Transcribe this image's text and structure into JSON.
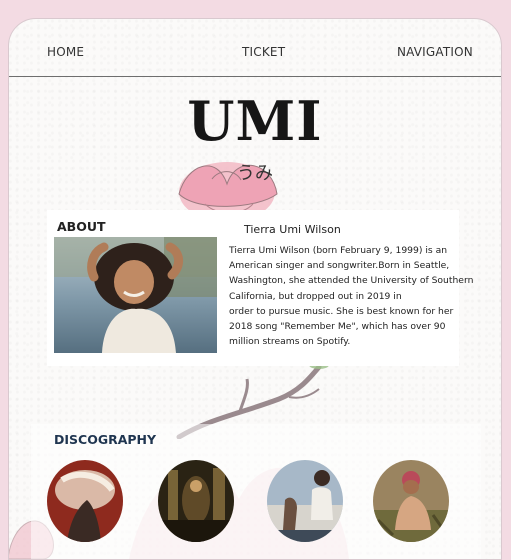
{
  "nav": {
    "home": "HOME",
    "ticket": "TICKET",
    "navigation": "NAVIGATION"
  },
  "hero": {
    "title": "UMI",
    "subtitle": "うみ"
  },
  "about": {
    "heading": "ABOUT",
    "name": "Tierra Umi Wilson",
    "lines": [
      "Tierra Umi Wilson (born February 9, 1999) is an",
      "American singer and songwriter.Born in Seattle,",
      "Washington, she attended the University of Southern",
      "California, but dropped out in 2019 in",
      "order to pursue music. She is best known for her",
      "2018 song \"Remember Me\", which has over 90",
      "million streams on Spotify."
    ]
  },
  "discography": {
    "heading": "DISCOGRAPHY"
  },
  "colors": {
    "background": "#f3dbe3",
    "page": "#fbfaf9",
    "accent_heading": "#1f3550"
  }
}
